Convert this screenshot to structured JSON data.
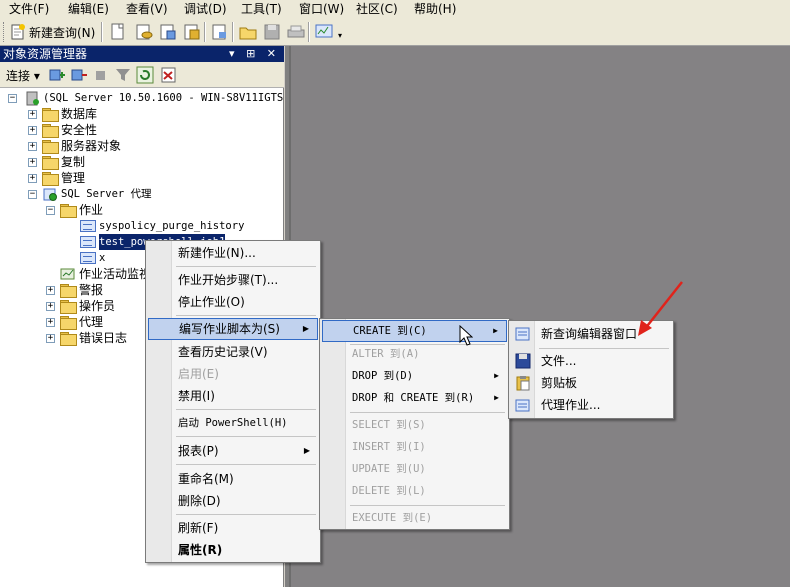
{
  "menubar": {
    "items": [
      "文件(F)",
      "编辑(E)",
      "查看(V)",
      "调试(D)",
      "工具(T)",
      "窗口(W)",
      "社区(C)",
      "帮助(H)"
    ]
  },
  "toolbar": {
    "new_query_label": "新建查询(N)"
  },
  "object_explorer": {
    "title": "对象资源管理器",
    "title_buttons": "▾ ⊞ ✕",
    "connect_label": "连接 ▾",
    "tree": {
      "server": "(SQL Server 10.50.1600 - WIN-S8V11IGTS",
      "databases": "数据库",
      "security": "安全性",
      "server_objects": "服务器对象",
      "replication": "复制",
      "management": "管理",
      "agent": "SQL Server 代理",
      "jobs": "作业",
      "job1": "syspolicy_purge_history",
      "job2": "test_powershell_job1",
      "job3": "x",
      "job_activity": "作业活动监视器",
      "alerts": "警报",
      "operators": "操作员",
      "proxies": "代理",
      "error_logs": "错误日志"
    }
  },
  "context_menu": {
    "new_job": "新建作业(N)...",
    "start_job": "作业开始步骤(T)...",
    "stop_job": "停止作业(O)",
    "script_job_as": "编写作业脚本为(S)",
    "view_history": "查看历史记录(V)",
    "enable": "启用(E)",
    "disable": "禁用(I)",
    "start_powershell": "启动 PowerShell(H)",
    "reports": "报表(P)",
    "rename": "重命名(M)",
    "delete": "删除(D)",
    "refresh": "刷新(F)",
    "properties": "属性(R)"
  },
  "script_submenu": {
    "create_to": "CREATE 到(C)",
    "alter_to": "ALTER 到(A)",
    "drop_to": "DROP 到(D)",
    "drop_create_to": "DROP 和 CREATE 到(R)",
    "select_to": "SELECT 到(S)",
    "insert_to": "INSERT 到(I)",
    "update_to": "UPDATE 到(U)",
    "delete_to": "DELETE 到(L)",
    "execute_to": "EXECUTE 到(E)"
  },
  "create_submenu": {
    "new_query_window": "新查询编辑器窗口",
    "file": "文件...",
    "clipboard": "剪贴板",
    "agent_job": "代理作业..."
  },
  "colors": {
    "title_bar": "#0a246a",
    "highlight": "#c1d2ee",
    "highlight_border": "#316ac5",
    "annotation_arrow": "#e0231b"
  }
}
